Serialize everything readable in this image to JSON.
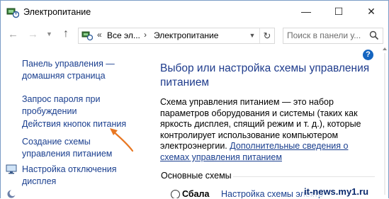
{
  "window": {
    "title": "Электропитание",
    "icon": "power-options-icon",
    "controls": {
      "minimize": "—",
      "maximize": "☐",
      "close": "✕"
    }
  },
  "navigation": {
    "back_icon": "arrow-left-icon",
    "forward_icon": "arrow-right-icon",
    "recent_icon": "chevron-down-icon",
    "up_icon": "arrow-up-icon",
    "address": {
      "overflow": "«",
      "crumbs": [
        "Все эл...",
        "Электропитание"
      ],
      "separator": "›",
      "refresh_icon": "refresh-icon"
    },
    "search": {
      "placeholder": "Поиск в панели у...",
      "icon": "search-icon"
    }
  },
  "sidebar": {
    "items": [
      {
        "label": "Панель управления — домашняя страница"
      },
      {
        "label": "Запрос пароля при пробуждении"
      },
      {
        "label": "Действия кнопок питания"
      },
      {
        "label": "Создание схемы управления питанием"
      },
      {
        "label": "Настройка отключения дисплея",
        "icon": "display-icon"
      }
    ],
    "annotation_arrow_color": "#e87722"
  },
  "main": {
    "help_label": "?",
    "heading": "Выбор или настройка схемы управления питанием",
    "description": "Схема управления питанием — это набор параметров оборудования и системы (таких как яркость дисплея, спящий режим и т. д.), которые контролирует использование компьютером электроэнергии.",
    "more_link": "Дополнительные сведения о схемах управления питанием",
    "section_title": "Основные схемы",
    "scheme": {
      "name": "Сбала",
      "settings_link": "Настройка схемы электр"
    }
  },
  "watermark": "it-news.my1.ru",
  "colors": {
    "link": "#1a3f8f",
    "heading": "#1e3b8c",
    "help": "#1565c0",
    "arrow": "#e87722"
  }
}
